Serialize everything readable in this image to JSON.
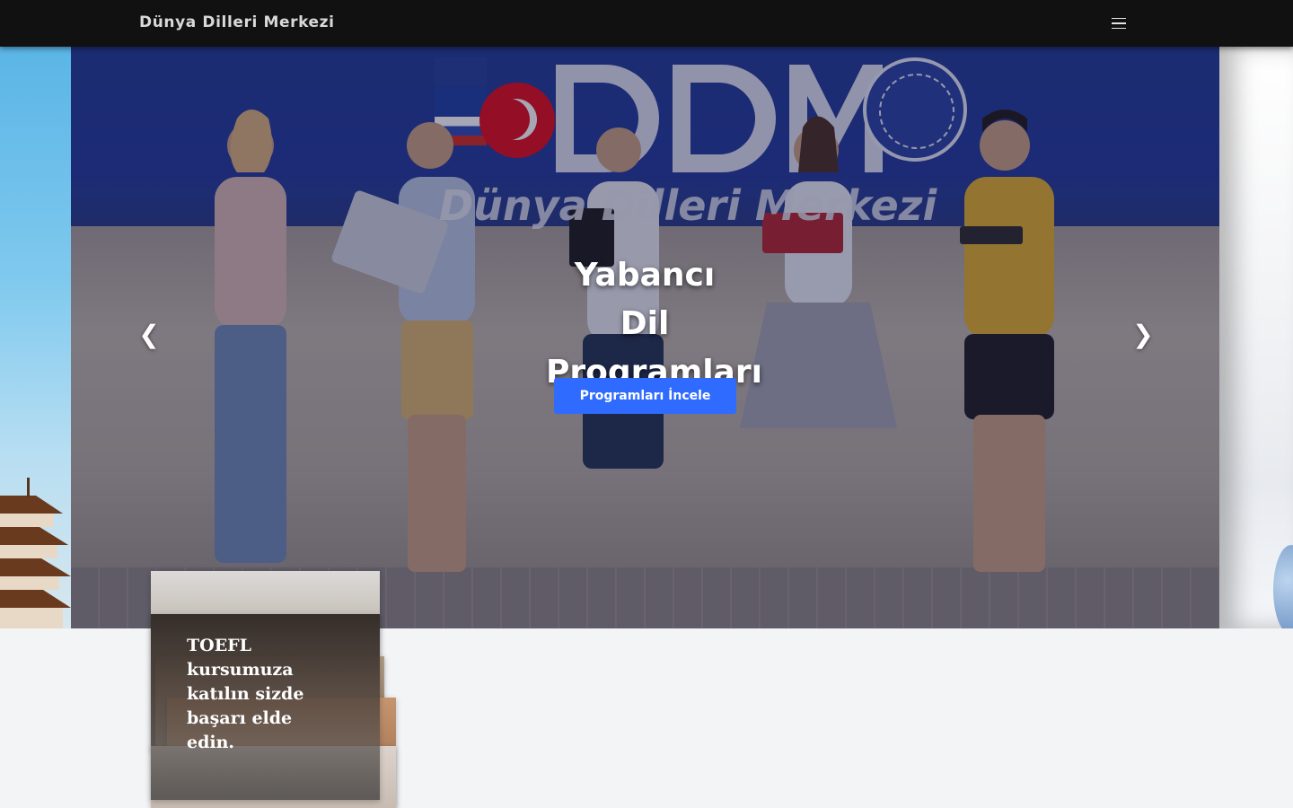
{
  "navbar": {
    "brand": "Dünya Dilleri Merkezi",
    "menu_icon": "hamburger-icon"
  },
  "hero": {
    "title": "Yabancı Dil Programları",
    "button_label": "Programları İncele",
    "prev_icon": "chevron-left-icon",
    "next_icon": "chevron-right-icon",
    "prev_glyph": "❮",
    "next_glyph": "❯",
    "accent_color": "#2f6bff"
  },
  "card": {
    "text": "TOEFL kursumuza katılın sizde başarı elde edin."
  },
  "colors": {
    "navbar_bg": "#111111",
    "page_bg": "#f3f4f6"
  }
}
